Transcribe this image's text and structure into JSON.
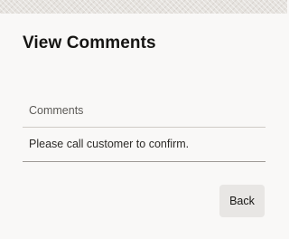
{
  "dialog": {
    "title": "View Comments"
  },
  "comments": {
    "header": "Comments",
    "rows": [
      {
        "text": "Please call customer to confirm."
      }
    ]
  },
  "actions": {
    "back_label": "Back"
  }
}
